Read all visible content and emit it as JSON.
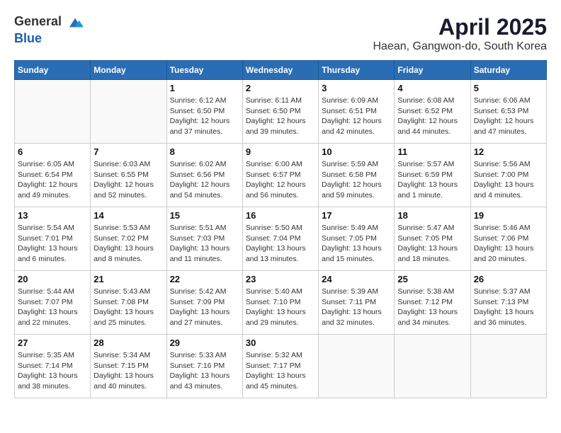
{
  "header": {
    "logo": {
      "general": "General",
      "blue": "Blue"
    },
    "title": "April 2025",
    "location": "Haean, Gangwon-do, South Korea"
  },
  "weekdays": [
    "Sunday",
    "Monday",
    "Tuesday",
    "Wednesday",
    "Thursday",
    "Friday",
    "Saturday"
  ],
  "weeks": [
    [
      {
        "day": null
      },
      {
        "day": null
      },
      {
        "day": "1",
        "sunrise": "Sunrise: 6:12 AM",
        "sunset": "Sunset: 6:50 PM",
        "daylight": "Daylight: 12 hours and 37 minutes."
      },
      {
        "day": "2",
        "sunrise": "Sunrise: 6:11 AM",
        "sunset": "Sunset: 6:50 PM",
        "daylight": "Daylight: 12 hours and 39 minutes."
      },
      {
        "day": "3",
        "sunrise": "Sunrise: 6:09 AM",
        "sunset": "Sunset: 6:51 PM",
        "daylight": "Daylight: 12 hours and 42 minutes."
      },
      {
        "day": "4",
        "sunrise": "Sunrise: 6:08 AM",
        "sunset": "Sunset: 6:52 PM",
        "daylight": "Daylight: 12 hours and 44 minutes."
      },
      {
        "day": "5",
        "sunrise": "Sunrise: 6:06 AM",
        "sunset": "Sunset: 6:53 PM",
        "daylight": "Daylight: 12 hours and 47 minutes."
      }
    ],
    [
      {
        "day": "6",
        "sunrise": "Sunrise: 6:05 AM",
        "sunset": "Sunset: 6:54 PM",
        "daylight": "Daylight: 12 hours and 49 minutes."
      },
      {
        "day": "7",
        "sunrise": "Sunrise: 6:03 AM",
        "sunset": "Sunset: 6:55 PM",
        "daylight": "Daylight: 12 hours and 52 minutes."
      },
      {
        "day": "8",
        "sunrise": "Sunrise: 6:02 AM",
        "sunset": "Sunset: 6:56 PM",
        "daylight": "Daylight: 12 hours and 54 minutes."
      },
      {
        "day": "9",
        "sunrise": "Sunrise: 6:00 AM",
        "sunset": "Sunset: 6:57 PM",
        "daylight": "Daylight: 12 hours and 56 minutes."
      },
      {
        "day": "10",
        "sunrise": "Sunrise: 5:59 AM",
        "sunset": "Sunset: 6:58 PM",
        "daylight": "Daylight: 12 hours and 59 minutes."
      },
      {
        "day": "11",
        "sunrise": "Sunrise: 5:57 AM",
        "sunset": "Sunset: 6:59 PM",
        "daylight": "Daylight: 13 hours and 1 minute."
      },
      {
        "day": "12",
        "sunrise": "Sunrise: 5:56 AM",
        "sunset": "Sunset: 7:00 PM",
        "daylight": "Daylight: 13 hours and 4 minutes."
      }
    ],
    [
      {
        "day": "13",
        "sunrise": "Sunrise: 5:54 AM",
        "sunset": "Sunset: 7:01 PM",
        "daylight": "Daylight: 13 hours and 6 minutes."
      },
      {
        "day": "14",
        "sunrise": "Sunrise: 5:53 AM",
        "sunset": "Sunset: 7:02 PM",
        "daylight": "Daylight: 13 hours and 8 minutes."
      },
      {
        "day": "15",
        "sunrise": "Sunrise: 5:51 AM",
        "sunset": "Sunset: 7:03 PM",
        "daylight": "Daylight: 13 hours and 11 minutes."
      },
      {
        "day": "16",
        "sunrise": "Sunrise: 5:50 AM",
        "sunset": "Sunset: 7:04 PM",
        "daylight": "Daylight: 13 hours and 13 minutes."
      },
      {
        "day": "17",
        "sunrise": "Sunrise: 5:49 AM",
        "sunset": "Sunset: 7:05 PM",
        "daylight": "Daylight: 13 hours and 15 minutes."
      },
      {
        "day": "18",
        "sunrise": "Sunrise: 5:47 AM",
        "sunset": "Sunset: 7:05 PM",
        "daylight": "Daylight: 13 hours and 18 minutes."
      },
      {
        "day": "19",
        "sunrise": "Sunrise: 5:46 AM",
        "sunset": "Sunset: 7:06 PM",
        "daylight": "Daylight: 13 hours and 20 minutes."
      }
    ],
    [
      {
        "day": "20",
        "sunrise": "Sunrise: 5:44 AM",
        "sunset": "Sunset: 7:07 PM",
        "daylight": "Daylight: 13 hours and 22 minutes."
      },
      {
        "day": "21",
        "sunrise": "Sunrise: 5:43 AM",
        "sunset": "Sunset: 7:08 PM",
        "daylight": "Daylight: 13 hours and 25 minutes."
      },
      {
        "day": "22",
        "sunrise": "Sunrise: 5:42 AM",
        "sunset": "Sunset: 7:09 PM",
        "daylight": "Daylight: 13 hours and 27 minutes."
      },
      {
        "day": "23",
        "sunrise": "Sunrise: 5:40 AM",
        "sunset": "Sunset: 7:10 PM",
        "daylight": "Daylight: 13 hours and 29 minutes."
      },
      {
        "day": "24",
        "sunrise": "Sunrise: 5:39 AM",
        "sunset": "Sunset: 7:11 PM",
        "daylight": "Daylight: 13 hours and 32 minutes."
      },
      {
        "day": "25",
        "sunrise": "Sunrise: 5:38 AM",
        "sunset": "Sunset: 7:12 PM",
        "daylight": "Daylight: 13 hours and 34 minutes."
      },
      {
        "day": "26",
        "sunrise": "Sunrise: 5:37 AM",
        "sunset": "Sunset: 7:13 PM",
        "daylight": "Daylight: 13 hours and 36 minutes."
      }
    ],
    [
      {
        "day": "27",
        "sunrise": "Sunrise: 5:35 AM",
        "sunset": "Sunset: 7:14 PM",
        "daylight": "Daylight: 13 hours and 38 minutes."
      },
      {
        "day": "28",
        "sunrise": "Sunrise: 5:34 AM",
        "sunset": "Sunset: 7:15 PM",
        "daylight": "Daylight: 13 hours and 40 minutes."
      },
      {
        "day": "29",
        "sunrise": "Sunrise: 5:33 AM",
        "sunset": "Sunset: 7:16 PM",
        "daylight": "Daylight: 13 hours and 43 minutes."
      },
      {
        "day": "30",
        "sunrise": "Sunrise: 5:32 AM",
        "sunset": "Sunset: 7:17 PM",
        "daylight": "Daylight: 13 hours and 45 minutes."
      },
      {
        "day": null
      },
      {
        "day": null
      },
      {
        "day": null
      }
    ]
  ]
}
